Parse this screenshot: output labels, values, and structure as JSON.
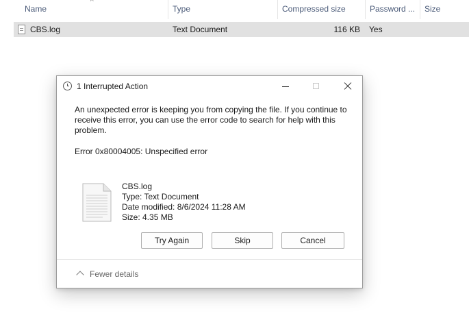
{
  "columns": {
    "name": "Name",
    "type": "Type",
    "compressed_size": "Compressed size",
    "password": "Password ...",
    "size": "Size"
  },
  "file_row": {
    "name": "CBS.log",
    "type": "Text Document",
    "compressed_size": "116 KB",
    "password": "Yes",
    "size": ""
  },
  "dialog": {
    "title": "1 Interrupted Action",
    "message": "An unexpected error is keeping you from copying the file. If you continue to receive this error, you can use the error code to search for help with this problem.",
    "error": "Error 0x80004005: Unspecified error",
    "file": {
      "name": "CBS.log",
      "type": "Type: Text Document",
      "modified": "Date modified: 8/6/2024 11:28 AM",
      "size": "Size: 4.35 MB"
    },
    "buttons": {
      "try_again": "Try Again",
      "skip": "Skip",
      "cancel": "Cancel"
    },
    "fewer_details": "Fewer details"
  },
  "icons": {
    "title": "clock-icon",
    "file": "text-document-icon",
    "details": "chevron-up-icon"
  }
}
